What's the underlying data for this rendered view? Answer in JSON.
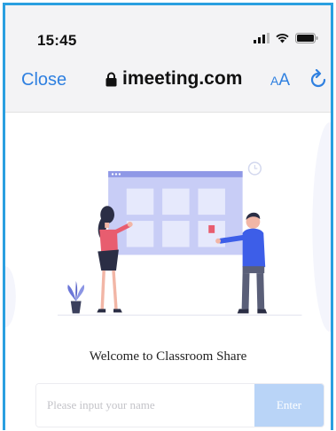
{
  "status_bar": {
    "time": "15:45"
  },
  "browser": {
    "close_label": "Close",
    "url": "imeeting.com",
    "text_size_big": "A",
    "text_size_small": "A"
  },
  "page": {
    "welcome_text": "Welcome to Classroom Share",
    "name_input": {
      "placeholder": "Please input your name",
      "value": ""
    },
    "enter_label": "Enter"
  },
  "colors": {
    "accent": "#2f80e0",
    "enter_button": "#b9d4f7",
    "board": "#bfc6f5",
    "figure_jacket": "#3d5ee8"
  }
}
